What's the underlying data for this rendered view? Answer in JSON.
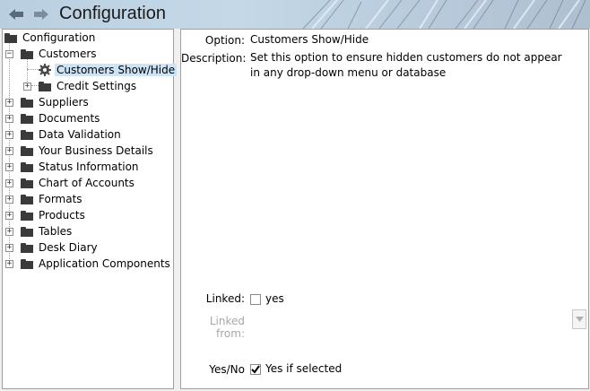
{
  "header": {
    "title": "Configuration",
    "back_icon": "arrow-left-icon",
    "forward_icon": "arrow-right-icon"
  },
  "tree": {
    "root": "Configuration",
    "customers": "Customers",
    "customers_show_hide": "Customers Show/Hide",
    "credit_settings": "Credit Settings",
    "items": [
      "Suppliers",
      "Documents",
      "Data Validation",
      "Your Business Details",
      "Status Information",
      "Chart of Accounts",
      "Formats",
      "Products",
      "Tables",
      "Desk Diary",
      "Application Components"
    ]
  },
  "detail": {
    "option_label": "Option:",
    "option_value": "Customers Show/Hide",
    "description_label": "Description:",
    "description_value": "Set this option to ensure hidden customers do not appear in any drop-down menu or database",
    "linked_label": "Linked:",
    "linked_checked": false,
    "linked_text": "yes",
    "linked_from_label": "Linked from:",
    "yesno_label": "Yes/No",
    "yesno_checked": true,
    "yesno_text": "Yes if selected"
  }
}
